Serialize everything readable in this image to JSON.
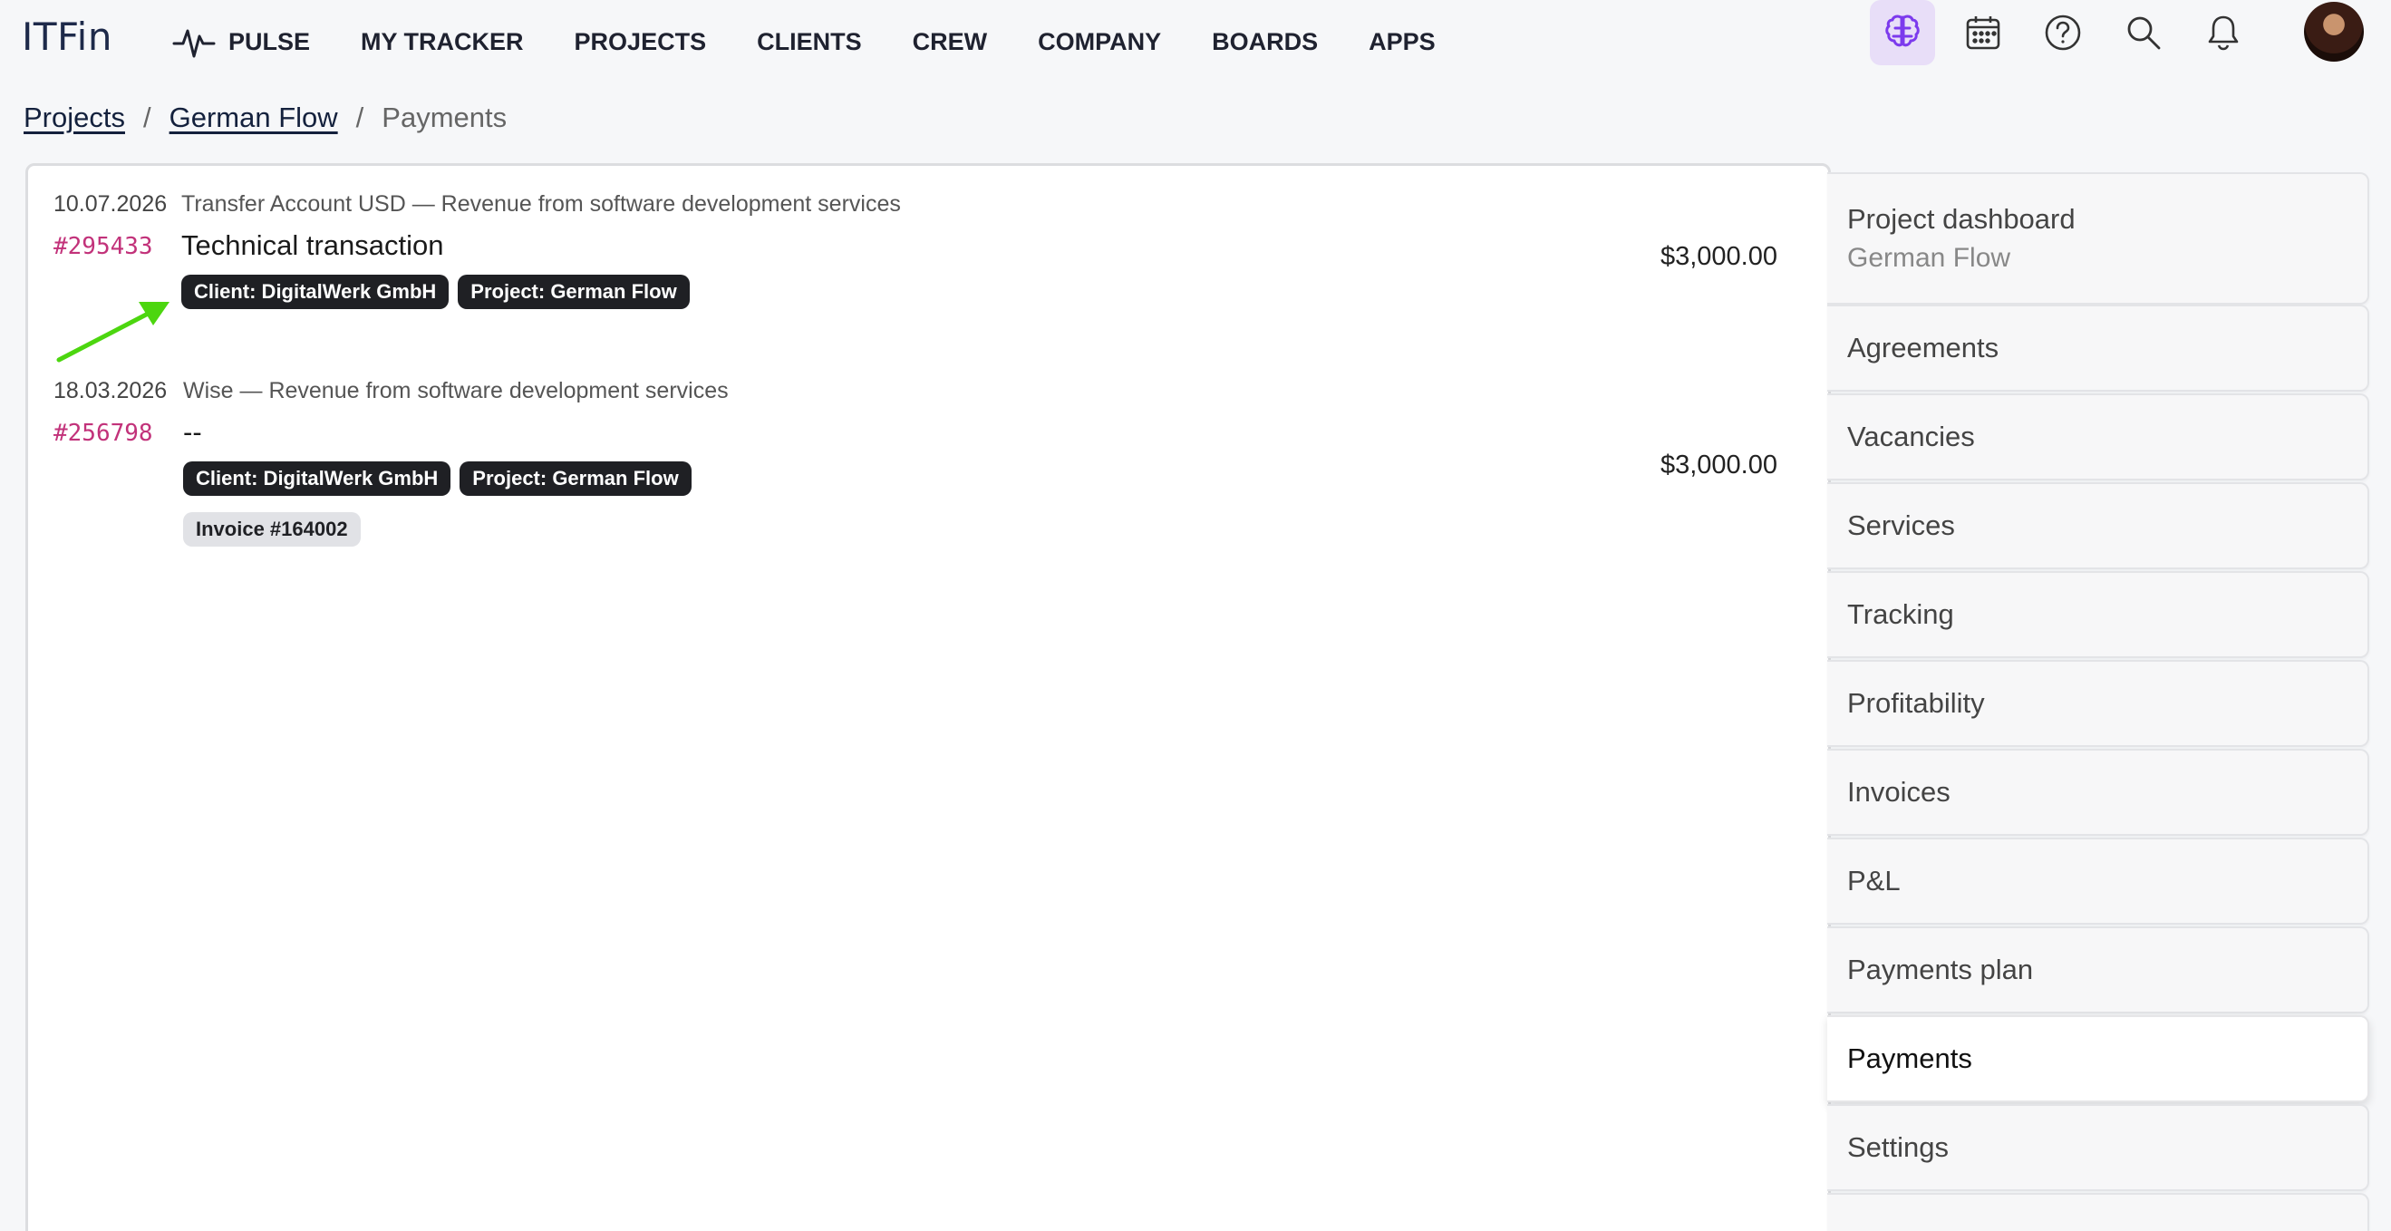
{
  "app": {
    "logo": "ITFin"
  },
  "nav": {
    "items": [
      {
        "label": "PULSE",
        "icon": "pulse-icon"
      },
      {
        "label": "MY TRACKER"
      },
      {
        "label": "PROJECTS"
      },
      {
        "label": "CLIENTS"
      },
      {
        "label": "CREW"
      },
      {
        "label": "COMPANY"
      },
      {
        "label": "BOARDS"
      },
      {
        "label": "APPS"
      }
    ],
    "icons": [
      "brain-icon",
      "calendar-icon",
      "help-icon",
      "search-icon",
      "bell-icon",
      "avatar"
    ],
    "accent": "#7c3aed"
  },
  "breadcrumb": {
    "items": [
      "Projects",
      "German Flow"
    ],
    "separator": "/",
    "current": "Payments"
  },
  "transactions": [
    {
      "date": "10.07.2026",
      "description": "Transfer Account USD — Revenue from software development services",
      "number": "#295433",
      "title": "Technical transaction",
      "amount": "$3,000.00",
      "tags": [
        "Client: DigitalWerk GmbH",
        "Project: German Flow"
      ]
    },
    {
      "date": "18.03.2026",
      "description": "Wise — Revenue from software development services",
      "number": "#256798",
      "title": "--",
      "amount": "$3,000.00",
      "tags": [
        "Client: DigitalWerk GmbH",
        "Project: German Flow"
      ],
      "invoice_tag": "Invoice #164002"
    }
  ],
  "side_menu": {
    "dashboard": {
      "label": "Project dashboard",
      "sub": "German Flow"
    },
    "items": [
      "Agreements",
      "Vacancies",
      "Services",
      "Tracking",
      "Profitability",
      "Invoices",
      "P&L",
      "Payments plan",
      "Payments",
      "Settings"
    ],
    "active": "Payments"
  },
  "colors": {
    "number": "#c2327a",
    "tag_dark": "#1f2024",
    "tag_light": "#e1e2e6",
    "arrow": "#4cd60f"
  }
}
